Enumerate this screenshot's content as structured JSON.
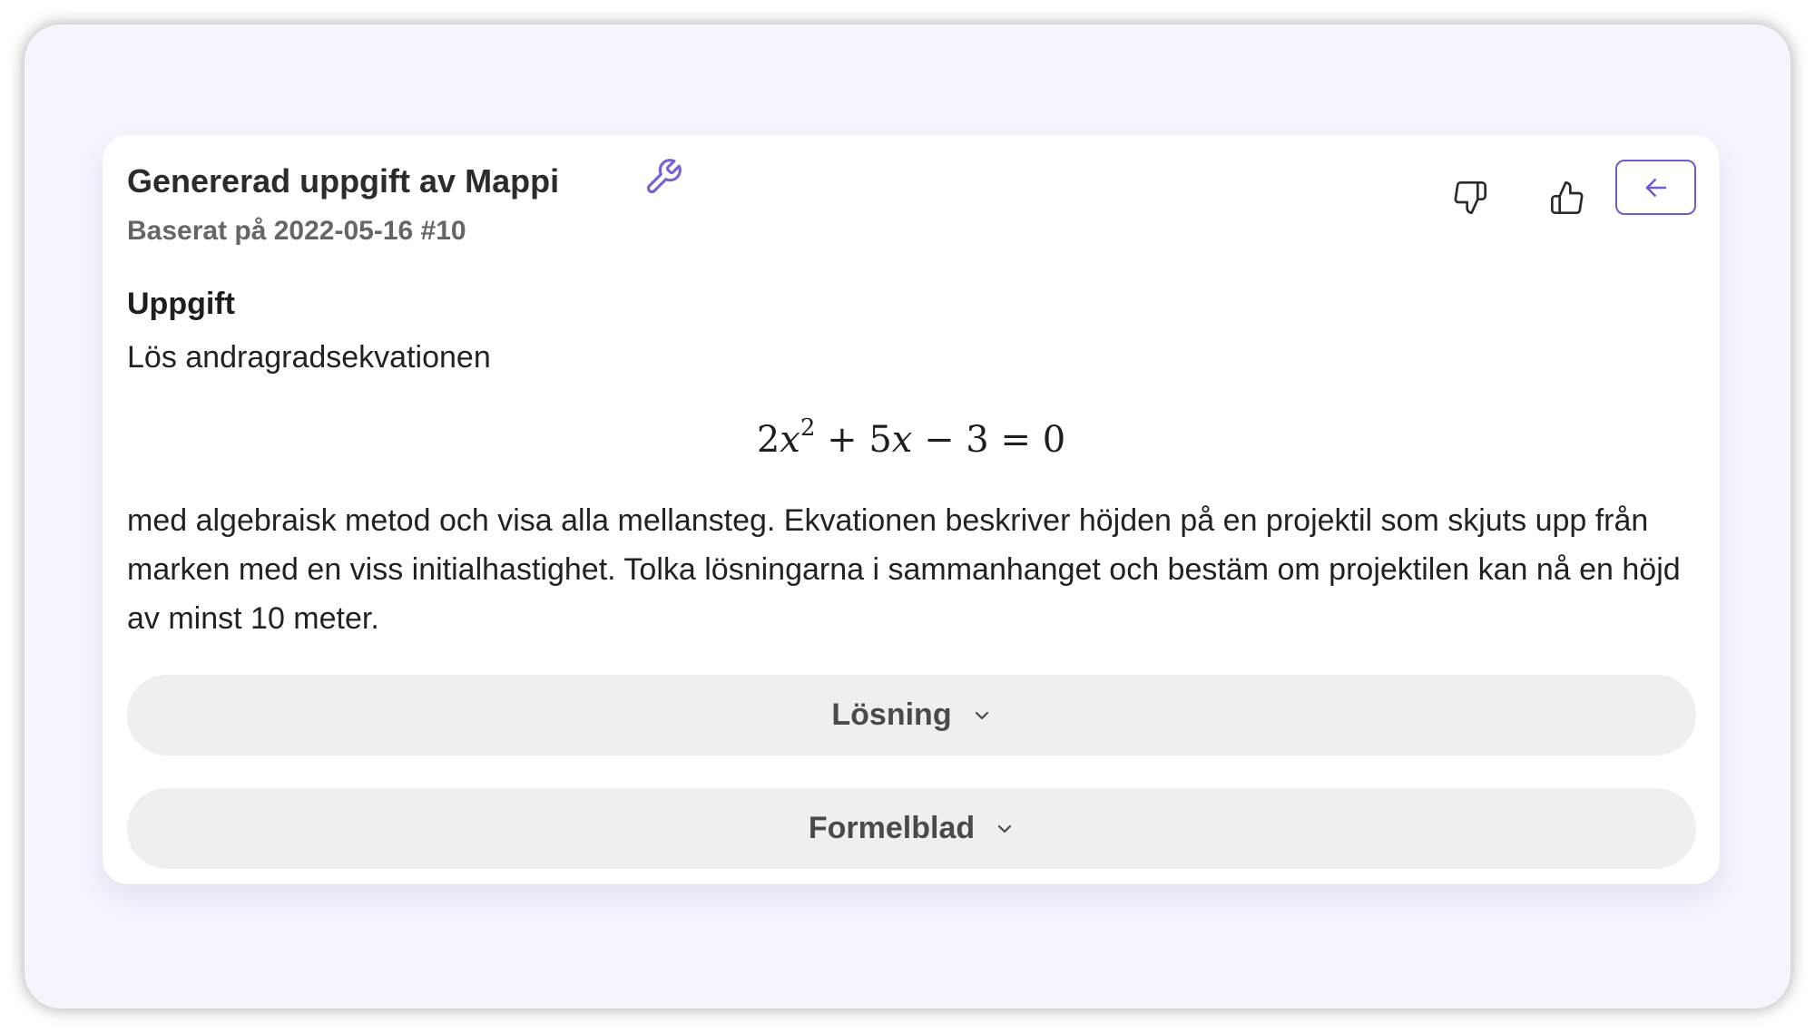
{
  "card": {
    "title": "Genererad uppgift av Mappi",
    "subtitle": "Baserat på 2022-05-16 #10",
    "tool_icon": "wrench-icon",
    "actions": {
      "thumbs_down_icon": "thumbs-down-icon",
      "thumbs_up_icon": "thumbs-up-icon",
      "back_icon": "arrow-left-icon"
    }
  },
  "task": {
    "heading": "Uppgift",
    "intro": "Lös andragradsekvationen",
    "equation": {
      "coef_a": "2",
      "var": "x",
      "exponent": "2",
      "rest": " + 5",
      "var2": "x",
      "tail": " − 3 = 0"
    },
    "body": "med algebraisk metod och visa alla mellansteg. Ekvationen beskriver höjden på en projektil som skjuts upp från marken med en viss initialhastighet. Tolka lösningarna i sammanhanget och bestäm om projektilen kan nå en höjd av minst 10 meter."
  },
  "accordions": {
    "solution_label": "Lösning",
    "formulas_label": "Formelblad"
  },
  "colors": {
    "accent": "#6b5bd6",
    "page_bg": "#f6f4fd",
    "accordion_bg": "#efefef"
  }
}
